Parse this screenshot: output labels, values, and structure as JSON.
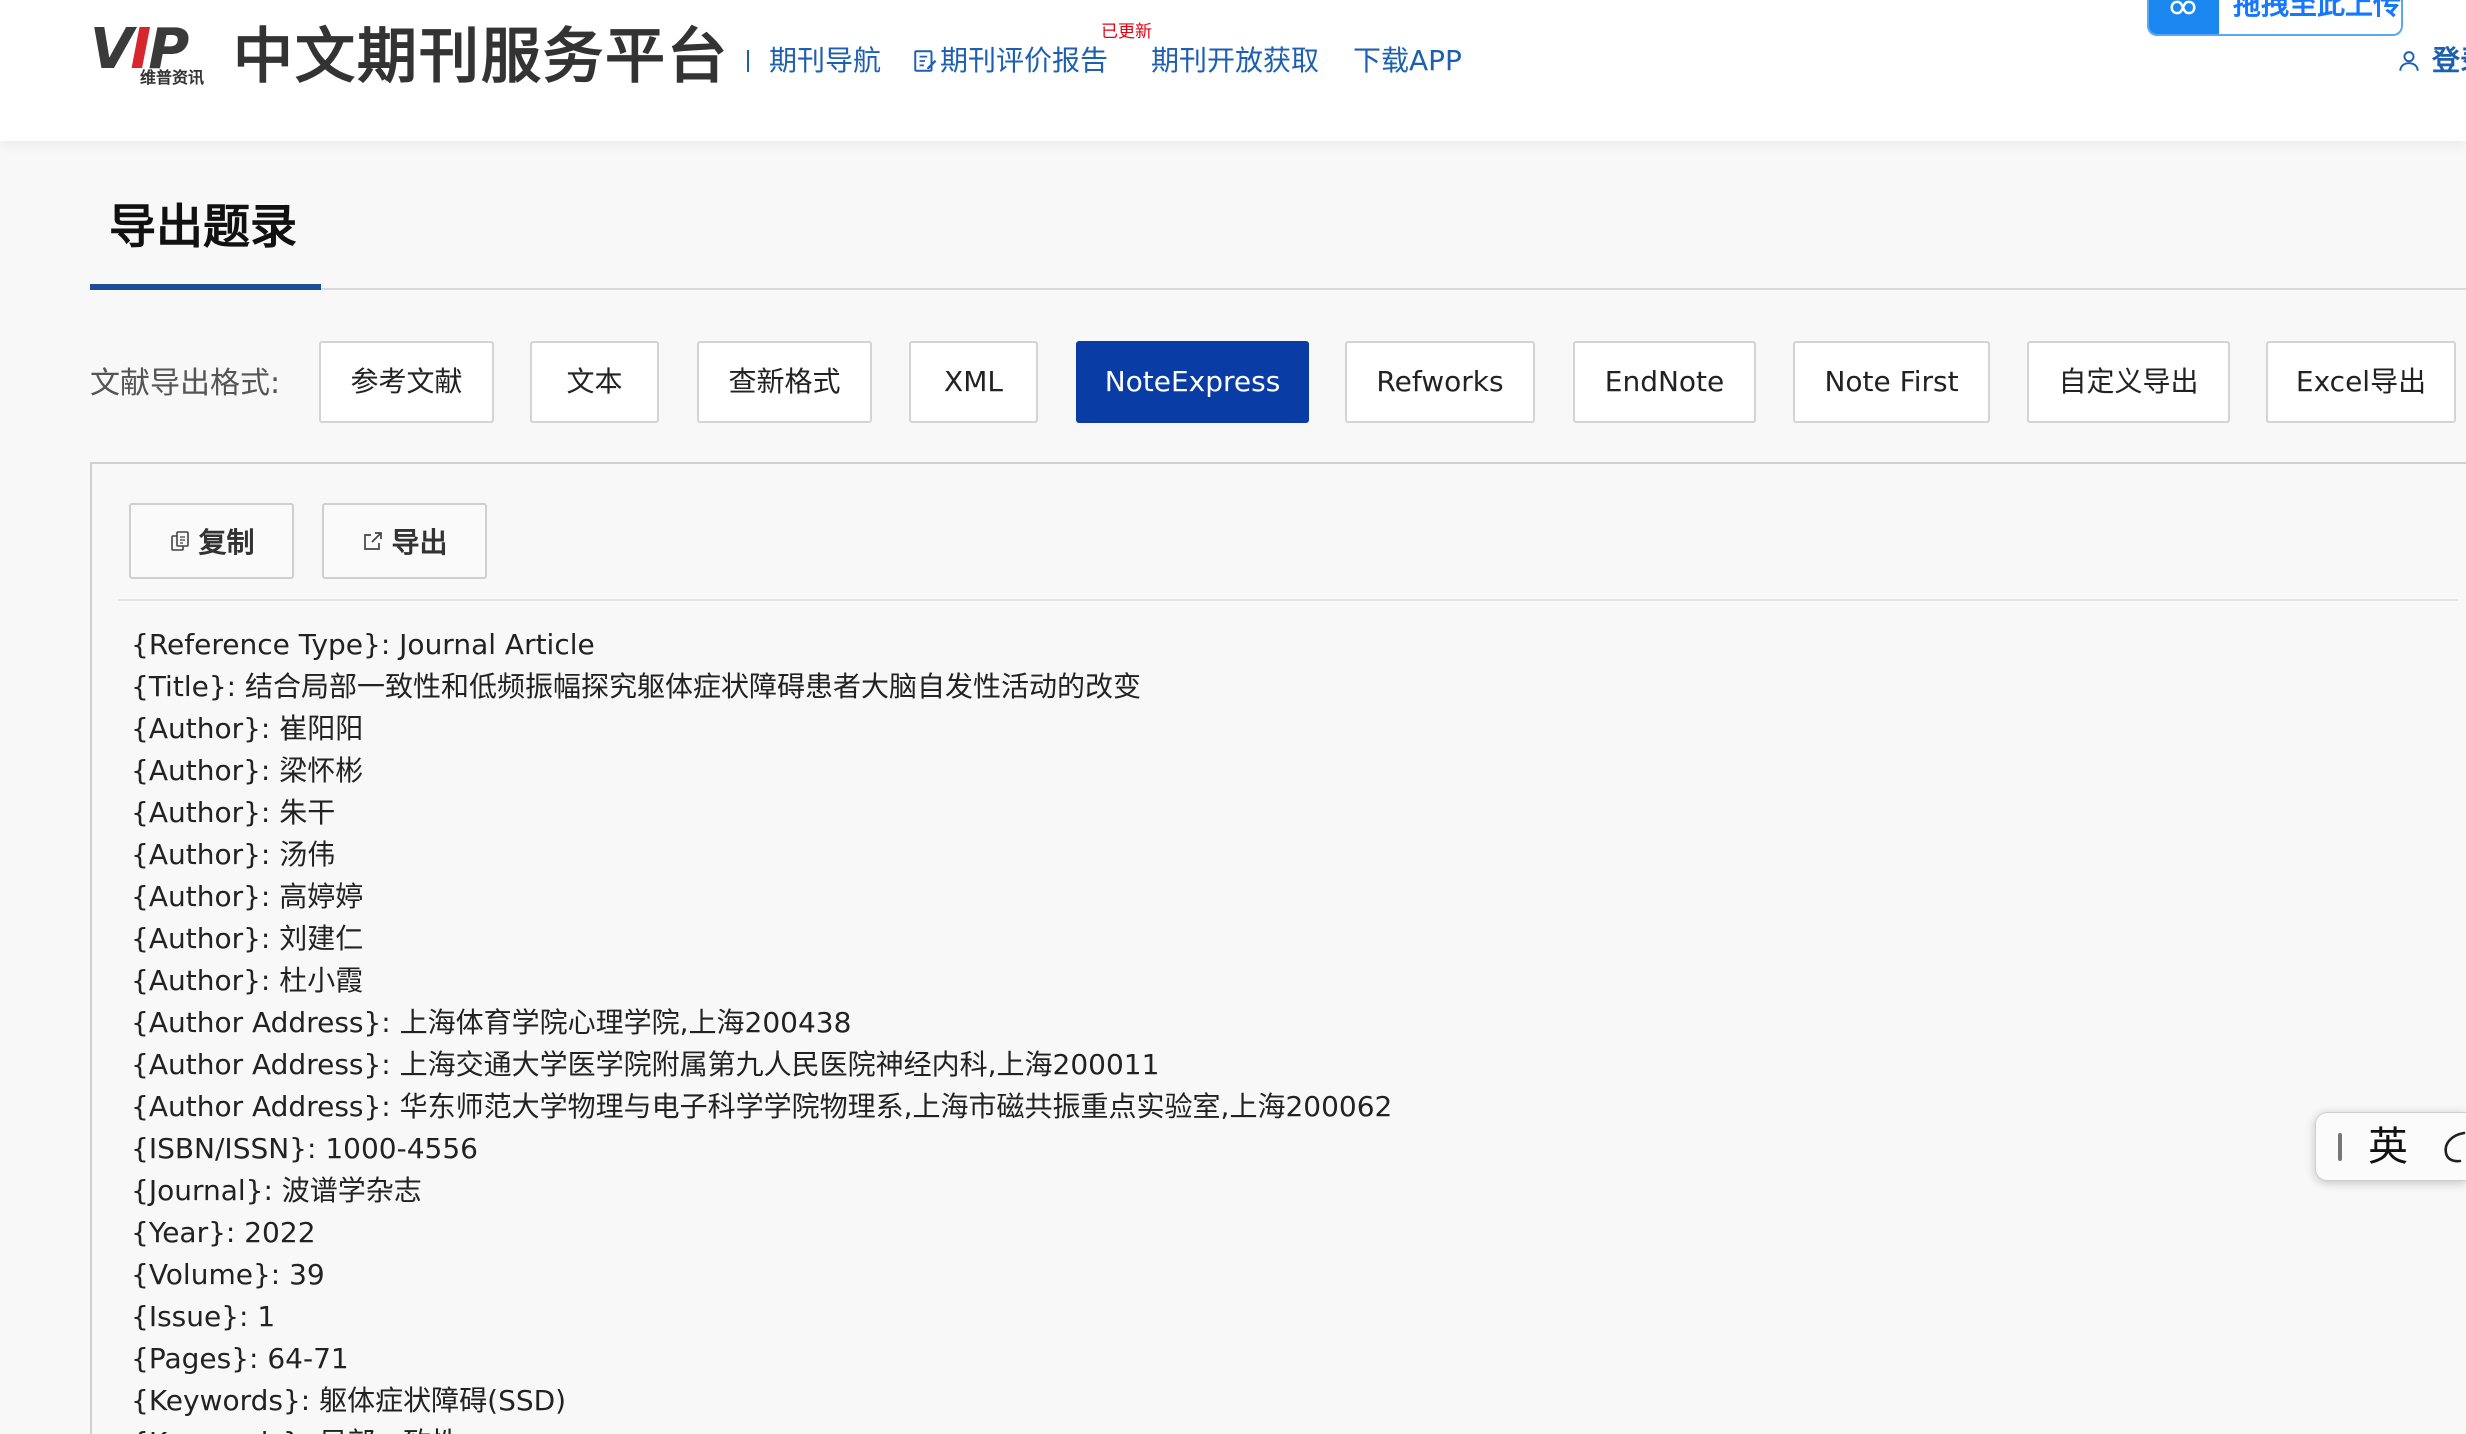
{
  "header": {
    "logo": {
      "letters": [
        "V",
        "I",
        "P"
      ],
      "subtitle": "维普资讯"
    },
    "site_title": "中文期刊服务平台",
    "nav": [
      {
        "label": "期刊导航"
      },
      {
        "label": "期刊评价报告",
        "icon": "report-icon",
        "badge": "已更新"
      },
      {
        "label": "期刊开放获取"
      },
      {
        "label": "下载APP"
      }
    ],
    "upload_button": {
      "label": "拖拽至此上传",
      "icon": "link-loop-icon"
    },
    "login": {
      "label": "登录",
      "icon": "user-icon"
    }
  },
  "page": {
    "title": "导出题录"
  },
  "format_bar": {
    "label": "文献导出格式:",
    "options": [
      "参考文献",
      "文本",
      "查新格式",
      "XML",
      "NoteExpress",
      "Refworks",
      "EndNote",
      "Note First",
      "自定义导出",
      "Excel导出"
    ],
    "selected_index": 4
  },
  "panel": {
    "actions": [
      {
        "label": "复制",
        "icon": "copy-icon"
      },
      {
        "label": "导出",
        "icon": "external-link-icon"
      }
    ],
    "lines": [
      "{Reference Type}: Journal Article",
      "{Title}: 结合局部一致性和低频振幅探究躯体症状障碍患者大脑自发性活动的改变",
      "{Author}: 崔阳阳",
      "{Author}: 梁怀彬",
      "{Author}: 朱干",
      "{Author}: 汤伟",
      "{Author}: 高婷婷",
      "{Author}: 刘建仁",
      "{Author}: 杜小霞",
      "{Author Address}: 上海体育学院心理学院,上海200438",
      "{Author Address}: 上海交通大学医学院附属第九人民医院神经内科,上海200011",
      "{Author Address}: 华东师范大学物理与电子科学学院物理系,上海市磁共振重点实验室,上海200062",
      "{ISBN/ISSN}: 1000-4556",
      "{Journal}: 波谱学杂志",
      "{Year}: 2022",
      "{Volume}: 39",
      "{Issue}: 1",
      "{Pages}: 64-71",
      "{Keywords}: 躯体症状障碍(SSD)",
      "{Keywords}: 局部一致性"
    ]
  },
  "ime": {
    "mode": "英",
    "icon": "ime-moon-icon"
  },
  "colors": {
    "accent": "#0a3ca6",
    "nav_link": "#1d5fb0",
    "badge": "#e60012",
    "upload": "#1a86f0",
    "title_underline": "#1e4a9a"
  }
}
